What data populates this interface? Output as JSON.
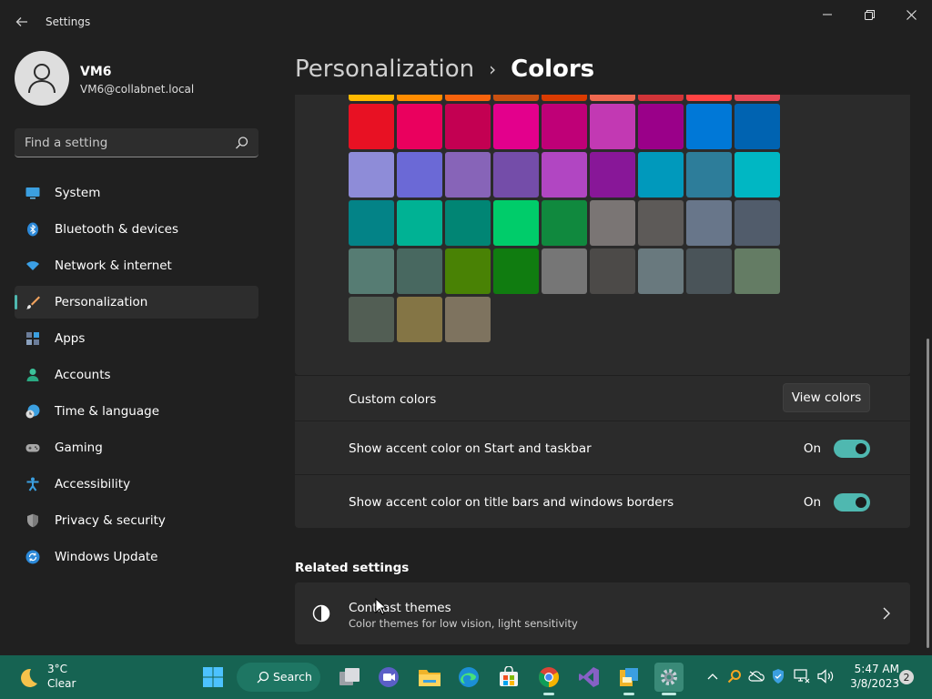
{
  "window": {
    "title": "Settings",
    "back_icon": "back-arrow-icon",
    "controls": [
      "minimize-icon",
      "maximize-icon",
      "close-icon"
    ]
  },
  "profile": {
    "name": "VM6",
    "email": "VM6@collabnet.local"
  },
  "search": {
    "placeholder": "Find a setting"
  },
  "sidebar": {
    "items": [
      {
        "label": "System",
        "icon": "system-display-icon",
        "active": false
      },
      {
        "label": "Bluetooth & devices",
        "icon": "bluetooth-icon",
        "active": false
      },
      {
        "label": "Network & internet",
        "icon": "wifi-icon",
        "active": false
      },
      {
        "label": "Personalization",
        "icon": "paintbrush-icon",
        "active": true
      },
      {
        "label": "Apps",
        "icon": "apps-icon",
        "active": false
      },
      {
        "label": "Accounts",
        "icon": "accounts-icon",
        "active": false
      },
      {
        "label": "Time & language",
        "icon": "globe-clock-icon",
        "active": false
      },
      {
        "label": "Gaming",
        "icon": "gamepad-icon",
        "active": false
      },
      {
        "label": "Accessibility",
        "icon": "accessibility-icon",
        "active": false
      },
      {
        "label": "Privacy & security",
        "icon": "shield-icon",
        "active": false
      },
      {
        "label": "Windows Update",
        "icon": "update-icon",
        "active": false
      }
    ]
  },
  "breadcrumb": {
    "parent": "Personalization",
    "separator": "›",
    "current": "Colors"
  },
  "accent_colors": [
    [
      "#ffb900",
      "#ff8c00",
      "#f7630c",
      "#ca5010",
      "#da3b01",
      "#ef6950",
      "#d13438",
      "#ff4343",
      "#e74856"
    ],
    [
      "#e81123",
      "#ea005e",
      "#c30052",
      "#e3008c",
      "#bf0077",
      "#c239b3",
      "#9a0089",
      "#0078d7",
      "#0063b1"
    ],
    [
      "#8e8cd8",
      "#6b69d6",
      "#8764b8",
      "#744da9",
      "#b146c2",
      "#881798",
      "#0099bc",
      "#2d7d9a",
      "#00b7c3"
    ],
    [
      "#038387",
      "#00b294",
      "#018574",
      "#00cc6a",
      "#10893e",
      "#7a7574",
      "#5d5a58",
      "#68768a",
      "#515c6b"
    ],
    [
      "#567c73",
      "#486860",
      "#498205",
      "#107c10",
      "#767676",
      "#4c4a48",
      "#69797e",
      "#4a5459",
      "#647c64"
    ],
    [
      "#525e54",
      "#847545",
      "#7e735f"
    ]
  ],
  "custom_colors": {
    "label": "Custom colors",
    "button": "View colors"
  },
  "toggles": [
    {
      "label": "Show accent color on Start and taskbar",
      "state": "On",
      "on": true
    },
    {
      "label": "Show accent color on title bars and windows borders",
      "state": "On",
      "on": true
    }
  ],
  "related": {
    "heading": "Related settings",
    "contrast": {
      "title": "Contrast themes",
      "subtitle": "Color themes for low vision, light sensitivity",
      "icon": "contrast-icon"
    }
  },
  "taskbar": {
    "weather": {
      "temp": "3°C",
      "condition": "Clear",
      "icon": "moon-icon"
    },
    "search_label": "Search",
    "apps": [
      "start-icon",
      "search-icon",
      "task-view-icon",
      "teams-chat-icon",
      "file-explorer-icon",
      "edge-icon",
      "store-icon",
      "chrome-icon",
      "visual-studio-icon",
      "package-icon",
      "settings-icon"
    ],
    "tray": [
      "chevron-up-icon",
      "search-tool-icon",
      "onedrive-icon",
      "security-icon",
      "network-icon",
      "volume-icon"
    ],
    "clock": {
      "time": "5:47 AM",
      "date": "3/8/2023"
    },
    "notifications": "2"
  },
  "colors": {
    "accent": "#4fb8b0",
    "taskbar": "#166352",
    "background": "#202020",
    "card": "#2b2b2b"
  }
}
